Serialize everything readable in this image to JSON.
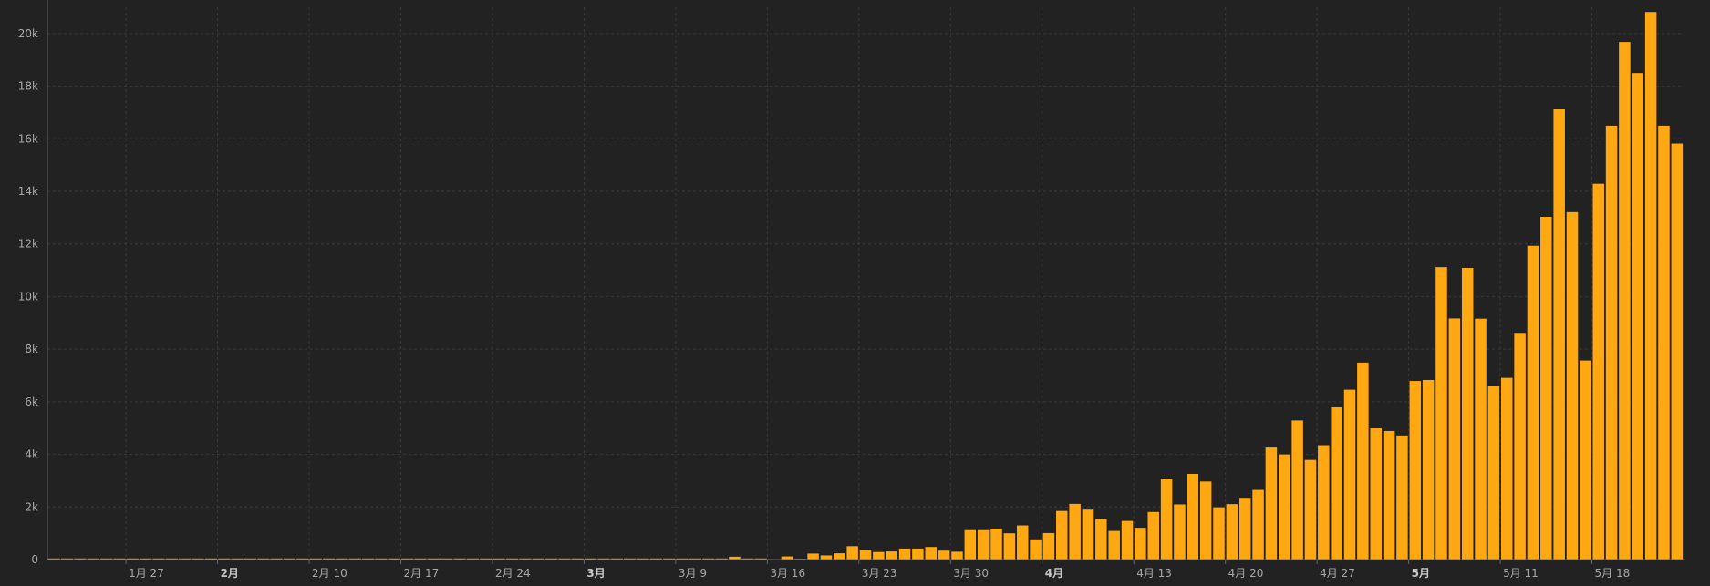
{
  "chart_data": {
    "type": "bar",
    "title": "",
    "xlabel": "",
    "ylabel": "",
    "ylim": [
      0,
      21000
    ],
    "grid": true,
    "bar_color": "#FFA812",
    "bar_edge_color": "#1a1a1a",
    "background_color": "#222222",
    "grid_color": "#3a3a3a",
    "axis_color": "#666666",
    "tick_label_color": "#a8a8a8",
    "y_ticks": [
      {
        "value": 0,
        "label": "0"
      },
      {
        "value": 2000,
        "label": "2k"
      },
      {
        "value": 4000,
        "label": "4k"
      },
      {
        "value": 6000,
        "label": "6k"
      },
      {
        "value": 8000,
        "label": "8k"
      },
      {
        "value": 10000,
        "label": "10k"
      },
      {
        "value": 12000,
        "label": "12k"
      },
      {
        "value": 14000,
        "label": "14k"
      },
      {
        "value": 16000,
        "label": "16k"
      },
      {
        "value": 18000,
        "label": "18k"
      },
      {
        "value": 20000,
        "label": "20k"
      }
    ],
    "x_ticks": [
      {
        "date": "1月 27",
        "label": "1月 27",
        "bold": false
      },
      {
        "date": "2月 3",
        "label": "2月",
        "bold": true
      },
      {
        "date": "2月 10",
        "label": "2月 10",
        "bold": false
      },
      {
        "date": "2月 17",
        "label": "2月 17",
        "bold": false
      },
      {
        "date": "2月 24",
        "label": "2月 24",
        "bold": false
      },
      {
        "date": "3月 2",
        "label": "3月",
        "bold": true
      },
      {
        "date": "3月 9",
        "label": "3月 9",
        "bold": false
      },
      {
        "date": "3月 16",
        "label": "3月 16",
        "bold": false
      },
      {
        "date": "3月 23",
        "label": "3月 23",
        "bold": false
      },
      {
        "date": "3月 30",
        "label": "3月 30",
        "bold": false
      },
      {
        "date": "4月 6",
        "label": "4月",
        "bold": true
      },
      {
        "date": "4月 13",
        "label": "4月 13",
        "bold": false
      },
      {
        "date": "4月 20",
        "label": "4月 20",
        "bold": false
      },
      {
        "date": "4月 27",
        "label": "4月 27",
        "bold": false
      },
      {
        "date": "5月 4",
        "label": "5月",
        "bold": true
      },
      {
        "date": "5月 11",
        "label": "5月 11",
        "bold": false
      },
      {
        "date": "5月 18",
        "label": "5月 18",
        "bold": false
      }
    ],
    "x": [
      "1月 21",
      "1月 22",
      "1月 23",
      "1月 24",
      "1月 25",
      "1月 26",
      "1月 27",
      "1月 28",
      "1月 29",
      "1月 30",
      "1月 31",
      "2月 1",
      "2月 2",
      "2月 3",
      "2月 4",
      "2月 5",
      "2月 6",
      "2月 7",
      "2月 8",
      "2月 9",
      "2月 10",
      "2月 11",
      "2月 12",
      "2月 13",
      "2月 14",
      "2月 15",
      "2月 16",
      "2月 17",
      "2月 18",
      "2月 19",
      "2月 20",
      "2月 21",
      "2月 22",
      "2月 23",
      "2月 24",
      "2月 25",
      "2月 26",
      "2月 27",
      "2月 28",
      "2月 29",
      "3月 1",
      "3月 2",
      "3月 3",
      "3月 4",
      "3月 5",
      "3月 6",
      "3月 7",
      "3月 8",
      "3月 9",
      "3月 10",
      "3月 11",
      "3月 12",
      "3月 13",
      "3月 14",
      "3月 15",
      "3月 16",
      "3月 17",
      "3月 18",
      "3月 19",
      "3月 20",
      "3月 21",
      "3月 22",
      "3月 23",
      "3月 24",
      "3月 25",
      "3月 26",
      "3月 27",
      "3月 28",
      "3月 29",
      "3月 30",
      "3月 31",
      "4月 1",
      "4月 2",
      "4月 3",
      "4月 4",
      "4月 5",
      "4月 6",
      "4月 7",
      "4月 8",
      "4月 9",
      "4月 10",
      "4月 11",
      "4月 12",
      "4月 13",
      "4月 14",
      "4月 15",
      "4月 16",
      "4月 17",
      "4月 18",
      "4月 19",
      "4月 20",
      "4月 21",
      "4月 22",
      "4月 23",
      "4月 24",
      "4月 25",
      "4月 26",
      "4月 27",
      "4月 28",
      "4月 29",
      "4月 30",
      "5月 1",
      "5月 2",
      "5月 3",
      "5月 4",
      "5月 5",
      "5月 6",
      "5月 7",
      "5月 8",
      "5月 9",
      "5月 10",
      "5月 11",
      "5月 12",
      "5月 13",
      "5月 14",
      "5月 15",
      "5月 16",
      "5月 17",
      "5月 18",
      "5月 19",
      "5月 20",
      "5月 21",
      "5月 22",
      "5月 23"
    ],
    "values": [
      0,
      0,
      0,
      0,
      0,
      0,
      0,
      0,
      0,
      0,
      0,
      0,
      0,
      0,
      0,
      0,
      0,
      0,
      0,
      0,
      0,
      0,
      0,
      0,
      0,
      0,
      0,
      0,
      0,
      0,
      0,
      0,
      0,
      0,
      0,
      0,
      0,
      0,
      0,
      0,
      0,
      0,
      0,
      0,
      0,
      0,
      0,
      0,
      0,
      0,
      0,
      0,
      120,
      0,
      0,
      30,
      130,
      40,
      240,
      170,
      250,
      520,
      380,
      300,
      320,
      430,
      430,
      490,
      350,
      310,
      1130,
      1130,
      1190,
      1010,
      1310,
      780,
      1020,
      1860,
      2130,
      1910,
      1560,
      1100,
      1480,
      1220,
      1820,
      3060,
      2110,
      3270,
      2980,
      2000,
      2120,
      2360,
      2660,
      4270,
      4010,
      5300,
      3800,
      4360,
      5800,
      6470,
      7500,
      5000,
      4900,
      4730,
      6800,
      6840,
      11130,
      9180,
      11100,
      9170,
      6600,
      6920,
      8630,
      11940,
      13040,
      17130,
      13220,
      7580,
      14300,
      16510,
      19690,
      18510,
      20830,
      16510,
      15830
    ]
  }
}
